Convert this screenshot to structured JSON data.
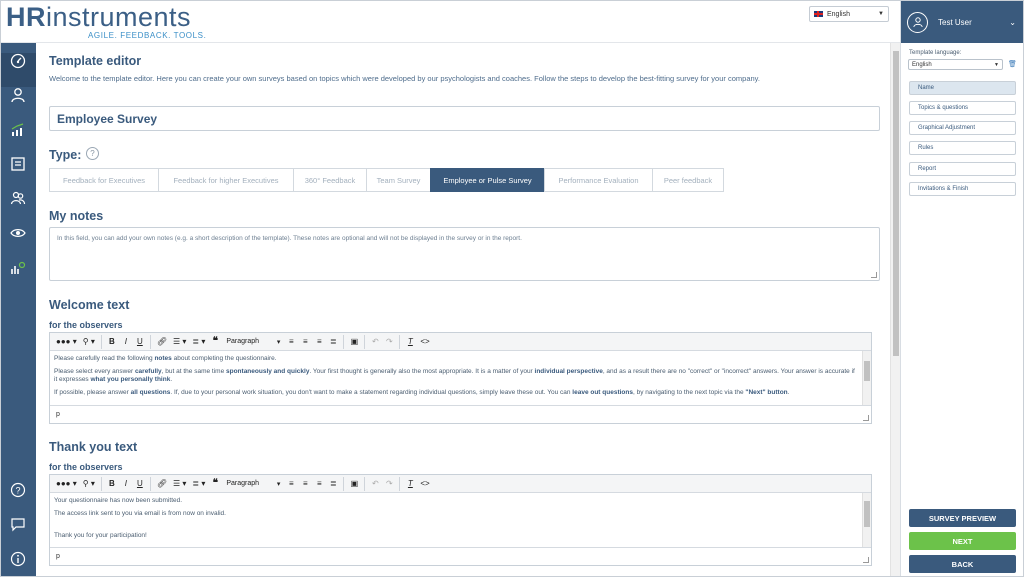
{
  "header": {
    "logo_hr": "HR",
    "logo_rest": "instruments",
    "tagline": "AGILE. FEEDBACK. TOOLS.",
    "language": "English"
  },
  "main": {
    "title": "Template editor",
    "intro": "Welcome to the template editor. Here you can create your own surveys based on topics which were developed by our psychologists and coaches. Follow the steps to develop the best-fitting survey for your company.",
    "survey_name": "Employee Survey",
    "type_label": "Type:",
    "help": "?",
    "types": [
      "Feedback for Executives",
      "Feedback for higher Executives",
      "360° Feedback",
      "Team Survey",
      "Employee or Pulse Survey",
      "Performance Evaluation",
      "Peer feedback"
    ],
    "active_type_index": 4,
    "notes_label": "My notes",
    "notes_placeholder": "In this field, you can add your own notes (e.g. a short description of the template). These notes are optional and will not be displayed in the survey or in the report.",
    "welcome_title": "Welcome text",
    "welcome_sub": "for the observers",
    "thanks_title": "Thank you text",
    "thanks_sub": "for the observers"
  },
  "editor": {
    "paragraph": "Paragraph",
    "status": "p",
    "welcome": {
      "p1a": "Please carefully read the following ",
      "p1b": "notes",
      "p1c": " about completing the questionnaire.",
      "p2a": "Please select every answer ",
      "p2b": "carefully",
      "p2c": ", but at the same time ",
      "p2d": "spontaneously and quickly",
      "p2e": ". Your first thought is generally also the most appropriate. It is a matter of your ",
      "p2f": "individual perspective",
      "p2g": ", and as a result there are no \"correct\" or \"incorrect\" answers. Your answer is accurate if it expresses ",
      "p2h": "what you personally think",
      "p2i": ".",
      "p3a": "If possible, please answer ",
      "p3b": "all questions",
      "p3c": ". If, due to your personal work situation, you don't want to make a statement regarding individual questions, simply leave these out. You can ",
      "p3d": "leave out questions",
      "p3e": ", by navigating to the next topic via the ",
      "p3f": "\"Next\" button",
      "p3g": "."
    },
    "thanks": {
      "p1": "Your questionnaire has now been submitted.",
      "p2": "The access link sent to you via email is from now on invalid.",
      "p3": "Thank you for your participation!"
    }
  },
  "right_panel": {
    "user": "Test User",
    "template_language_label": "Template language:",
    "template_language": "English",
    "steps": [
      "Name",
      "Topics & questions",
      "Graphical Adjustment",
      "Rules",
      "Report",
      "Invitations & Finish"
    ],
    "active_step_index": 0,
    "preview_label": "SURVEY PREVIEW",
    "next_label": "NEXT",
    "back_label": "BACK"
  },
  "colors": {
    "primary": "#3a5a7d",
    "next_green": "#6cc24a",
    "logo_accent": "#3b8fc7"
  }
}
